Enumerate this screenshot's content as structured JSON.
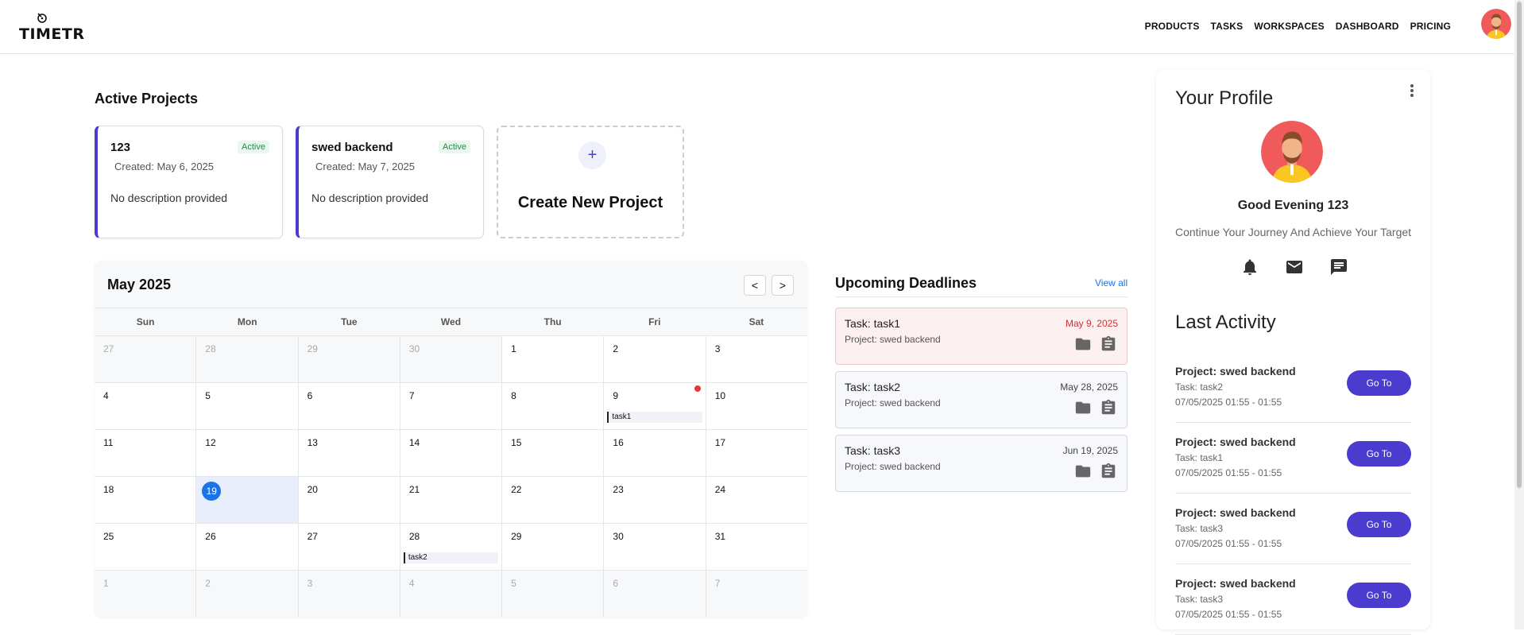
{
  "header": {
    "logo_text": "TIMETR",
    "nav": [
      "PRODUCTS",
      "TASKS",
      "WORKSPACES",
      "DASHBOARD",
      "PRICING"
    ]
  },
  "active_projects": {
    "title": "Active Projects",
    "projects": [
      {
        "name": "123",
        "status": "Active",
        "created": "Created: May 6, 2025",
        "description": "No description provided"
      },
      {
        "name": "swed backend",
        "status": "Active",
        "created": "Created: May 7, 2025",
        "description": "No description provided"
      }
    ],
    "create_label": "Create New Project",
    "create_icon": "+"
  },
  "calendar": {
    "title": "May 2025",
    "prev_label": "<",
    "next_label": ">",
    "weekdays": [
      "Sun",
      "Mon",
      "Tue",
      "Wed",
      "Thu",
      "Fri",
      "Sat"
    ],
    "weeks": [
      [
        {
          "d": "27",
          "other": true
        },
        {
          "d": "28",
          "other": true
        },
        {
          "d": "29",
          "other": true
        },
        {
          "d": "30",
          "other": true
        },
        {
          "d": "1"
        },
        {
          "d": "2"
        },
        {
          "d": "3"
        }
      ],
      [
        {
          "d": "4"
        },
        {
          "d": "5"
        },
        {
          "d": "6"
        },
        {
          "d": "7"
        },
        {
          "d": "8"
        },
        {
          "d": "9",
          "event": "task1",
          "dot": true
        },
        {
          "d": "10"
        }
      ],
      [
        {
          "d": "11"
        },
        {
          "d": "12"
        },
        {
          "d": "13"
        },
        {
          "d": "14"
        },
        {
          "d": "15"
        },
        {
          "d": "16"
        },
        {
          "d": "17"
        }
      ],
      [
        {
          "d": "18"
        },
        {
          "d": "19",
          "today": true
        },
        {
          "d": "20"
        },
        {
          "d": "21"
        },
        {
          "d": "22"
        },
        {
          "d": "23"
        },
        {
          "d": "24"
        }
      ],
      [
        {
          "d": "25"
        },
        {
          "d": "26"
        },
        {
          "d": "27"
        },
        {
          "d": "28",
          "event": "task2"
        },
        {
          "d": "29"
        },
        {
          "d": "30"
        },
        {
          "d": "31"
        }
      ],
      [
        {
          "d": "1",
          "other": true
        },
        {
          "d": "2",
          "other": true
        },
        {
          "d": "3",
          "other": true
        },
        {
          "d": "4",
          "other": true
        },
        {
          "d": "5",
          "other": true
        },
        {
          "d": "6",
          "other": true
        },
        {
          "d": "7",
          "other": true
        }
      ]
    ]
  },
  "deadlines": {
    "title": "Upcoming Deadlines",
    "view_all": "View all",
    "items": [
      {
        "task": "Task: task1",
        "project": "Project: swed backend",
        "date": "May 9, 2025",
        "overdue": true
      },
      {
        "task": "Task: task2",
        "project": "Project: swed backend",
        "date": "May 28, 2025",
        "overdue": false
      },
      {
        "task": "Task: task3",
        "project": "Project: swed backend",
        "date": "Jun 19, 2025",
        "overdue": false
      }
    ]
  },
  "profile": {
    "title": "Your Profile",
    "greeting": "Good Evening 123",
    "subtitle": "Continue Your Journey And Achieve Your Target",
    "icons": [
      "bell-icon",
      "mail-icon",
      "chat-icon"
    ]
  },
  "last_activity": {
    "title": "Last Activity",
    "button_label": "Go To",
    "items": [
      {
        "project": "Project: swed backend",
        "task": "Task: task2",
        "time": "07/05/2025 01:55 - 01:55"
      },
      {
        "project": "Project: swed backend",
        "task": "Task: task1",
        "time": "07/05/2025 01:55 - 01:55"
      },
      {
        "project": "Project: swed backend",
        "task": "Task: task3",
        "time": "07/05/2025 01:55 - 01:55"
      },
      {
        "project": "Project: swed backend",
        "task": "Task: task3",
        "time": "07/05/2025 01:55 - 01:55"
      }
    ]
  },
  "colors": {
    "accent": "#4b3ccf",
    "link": "#1a73e8",
    "overdue": "#d32f2f",
    "today": "#1a73e8"
  }
}
